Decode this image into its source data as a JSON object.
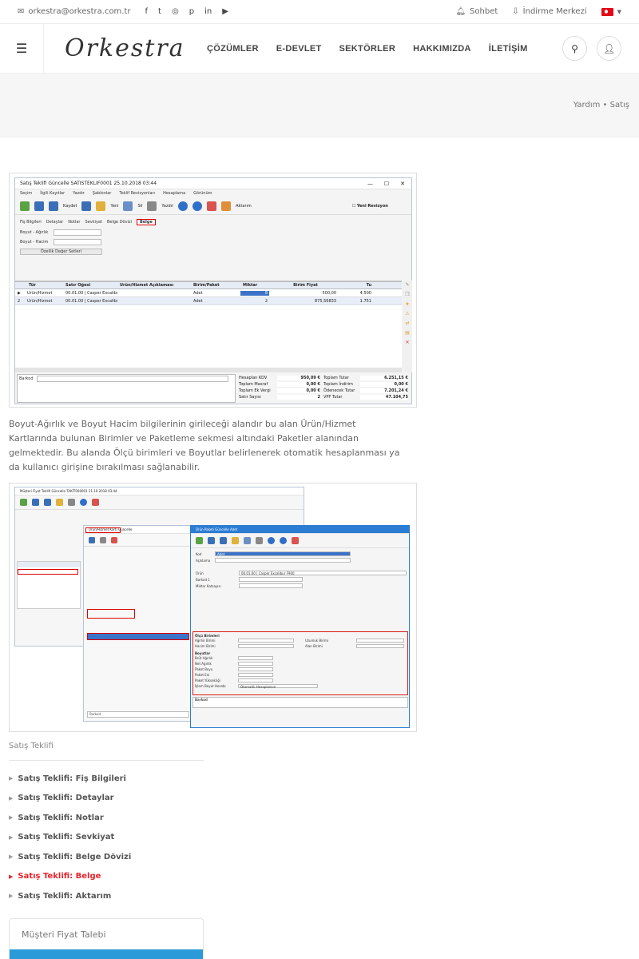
{
  "topbar": {
    "email": "orkestra@orkestra.com.tr",
    "social": [
      "f",
      "t",
      "◎",
      "p",
      "in",
      "▶"
    ],
    "chat": "Sohbet",
    "download": "İndirme Merkezi"
  },
  "header": {
    "logo": "Orkestra",
    "nav": [
      "ÇÖZÜMLER",
      "E-DEVLET",
      "SEKTÖRLER",
      "HAKKIMIZDA",
      "İLETİŞİM"
    ]
  },
  "breadcrumb": "Yardım • Satış",
  "screenshot1": {
    "title": "Satış Teklifi Güncelle  SATISTEKLIF0001  25.10.2018 03:44",
    "menu": [
      "Seçim",
      "İlgili Kayıtlar",
      "Yazdır",
      "Şablonlar",
      "Teklif Revizyonları",
      "Hesaplama",
      "Görünüm"
    ],
    "toolbar": [
      "Kaydet",
      "Yeni",
      "Sil",
      "Yazdır",
      "Aktarım"
    ],
    "revision_label": "Yeni Revizyon",
    "tabs": [
      "Fiş Bilgileri",
      "Detaylar",
      "Notlar",
      "Sevkiyat",
      "Belge Dövizi",
      "Belge"
    ],
    "fields": {
      "weight": "Boyut - Ağırlık",
      "volume": "Boyut - Hacim",
      "button": "Özellik Değer Setleri"
    },
    "grid": {
      "headers": [
        "Tür",
        "Satır Öğesi",
        "Ürün/Hizmet Açıklaması",
        "Birim/Paket",
        "Miktar",
        "Birim Fiyat",
        "Tu"
      ],
      "rows": [
        [
          "Ürün/Hizmet",
          "00.01.00 | Casper Excalibur",
          "",
          "Adet",
          "8",
          "500,00",
          "4.500"
        ],
        [
          "Ürün/Hizmet",
          "00.01.00 | Casper Excalibur",
          "",
          "Adet",
          "2",
          "875,56833",
          "1.751"
        ]
      ]
    },
    "barkod": "Barkod",
    "totals_left": [
      [
        "Hesaplan KDV",
        "950,09 €"
      ],
      [
        "Toplam Masraf",
        "0,00 €"
      ],
      [
        "Toplam Ek Vergi",
        "0,00 €"
      ],
      [
        "Satır Sayısı",
        "2"
      ]
    ],
    "totals_right": [
      [
        "Toplam Tutar",
        "6.251,15 €"
      ],
      [
        "Toplam İndirim",
        "0,00 €"
      ],
      [
        "Ödenecek Tutar",
        "7.201,24 €"
      ],
      [
        "VPF Tutar",
        "47.104,75"
      ]
    ]
  },
  "paragraph": "Boyut-Ağırlık ve Boyut Hacim bilgilerinin girileceği alandır bu alan Ürün/Hizmet Kartlarında bulunan Birimler ve Paketleme sekmesi altındaki Paketler alanından gelmektedir. Bu alanda Ölçü birimleri ve Boyutlar belirlenerek otomatik hesaplanması ya da kullanıcı girişine bırakılması sağlanabilir.",
  "screenshot2": {
    "back_title": "Müşteri Fiyat Teklifi Güncelle  TAKİT000001  21.10.2018 03:44",
    "mid_title": "Ürün/Hizmet Kartı Güncelle",
    "front_title": "Ürün Paketi Güncelle  Adet",
    "front_fields": [
      "Kod",
      "Açıklama",
      "Ürün",
      "Barkod 1",
      "Miktar Katsayısı"
    ],
    "code_value": "Adet",
    "product_value": "00.01.00 | Casper Excalibur F900",
    "section_dims": "Ölçü Birimleri",
    "section_size": "Boyutlar",
    "dim_fields": [
      "Ağırlık Birimi",
      "Uzunluk Birimi",
      "Hacim Birimi",
      "Alan Birimi"
    ],
    "size_fields": [
      "Brüt Ağırlık",
      "Net Ağırlık",
      "Paket Boyu",
      "Paket Eni",
      "Paket Yüksekliği",
      "İşlem Boyut Hesabı"
    ],
    "calc_value": "Otomatik Hesaplansın",
    "barkod": "Barkod"
  },
  "sidebar": {
    "title": "Satış Teklifi",
    "items": [
      "Satış Teklifi: Fiş Bilgileri",
      "Satış Teklifi: Detaylar",
      "Satış Teklifi: Notlar",
      "Satış Teklifi: Sevkiyat",
      "Satış Teklifi: Belge Dövizi",
      "Satış Teklifi: Belge",
      "Satış Teklifi: Aktarım"
    ],
    "active_index": 5
  },
  "card": {
    "title": "Müşteri Fiyat Talebi"
  },
  "colors": {
    "accent": "#e8232a",
    "card_bar": "#2b9ad8",
    "selection": "#3b73c8"
  }
}
